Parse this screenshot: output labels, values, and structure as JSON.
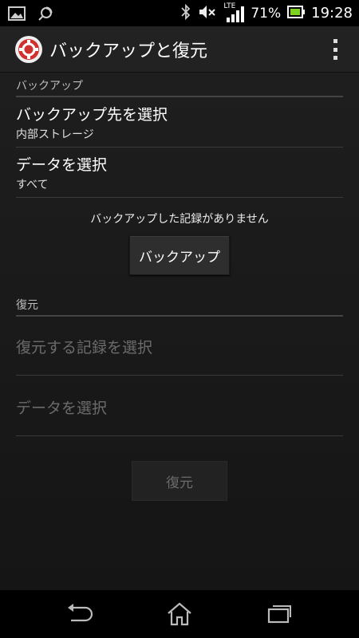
{
  "status_bar": {
    "network_label": "LTE",
    "battery_percent": "71%",
    "time": "19:28",
    "icons": [
      "gallery-icon",
      "sync-icon",
      "bluetooth-icon",
      "mute-icon",
      "signal-icon",
      "battery-icon"
    ]
  },
  "action_bar": {
    "title": "バックアップと復元",
    "app_icon": "backup-restore-app-icon",
    "overflow_icon": "overflow-menu-icon"
  },
  "backup_section": {
    "header": "バックアップ",
    "destination": {
      "title": "バックアップ先を選択",
      "summary": "内部ストレージ"
    },
    "data": {
      "title": "データを選択",
      "summary": "すべて"
    },
    "no_records_text": "バックアップした記録がありません",
    "backup_button": "バックアップ"
  },
  "restore_section": {
    "header": "復元",
    "record": {
      "title": "復元する記録を選択"
    },
    "data": {
      "title": "データを選択"
    },
    "restore_button": "復元"
  },
  "nav_bar": {
    "icons": [
      "back-icon",
      "home-icon",
      "recent-apps-icon"
    ]
  },
  "colors": {
    "background": "#1a1a1a",
    "text": "#ffffff",
    "disabled_text": "#6b6b6b",
    "app_icon_red": "#d0312d"
  }
}
